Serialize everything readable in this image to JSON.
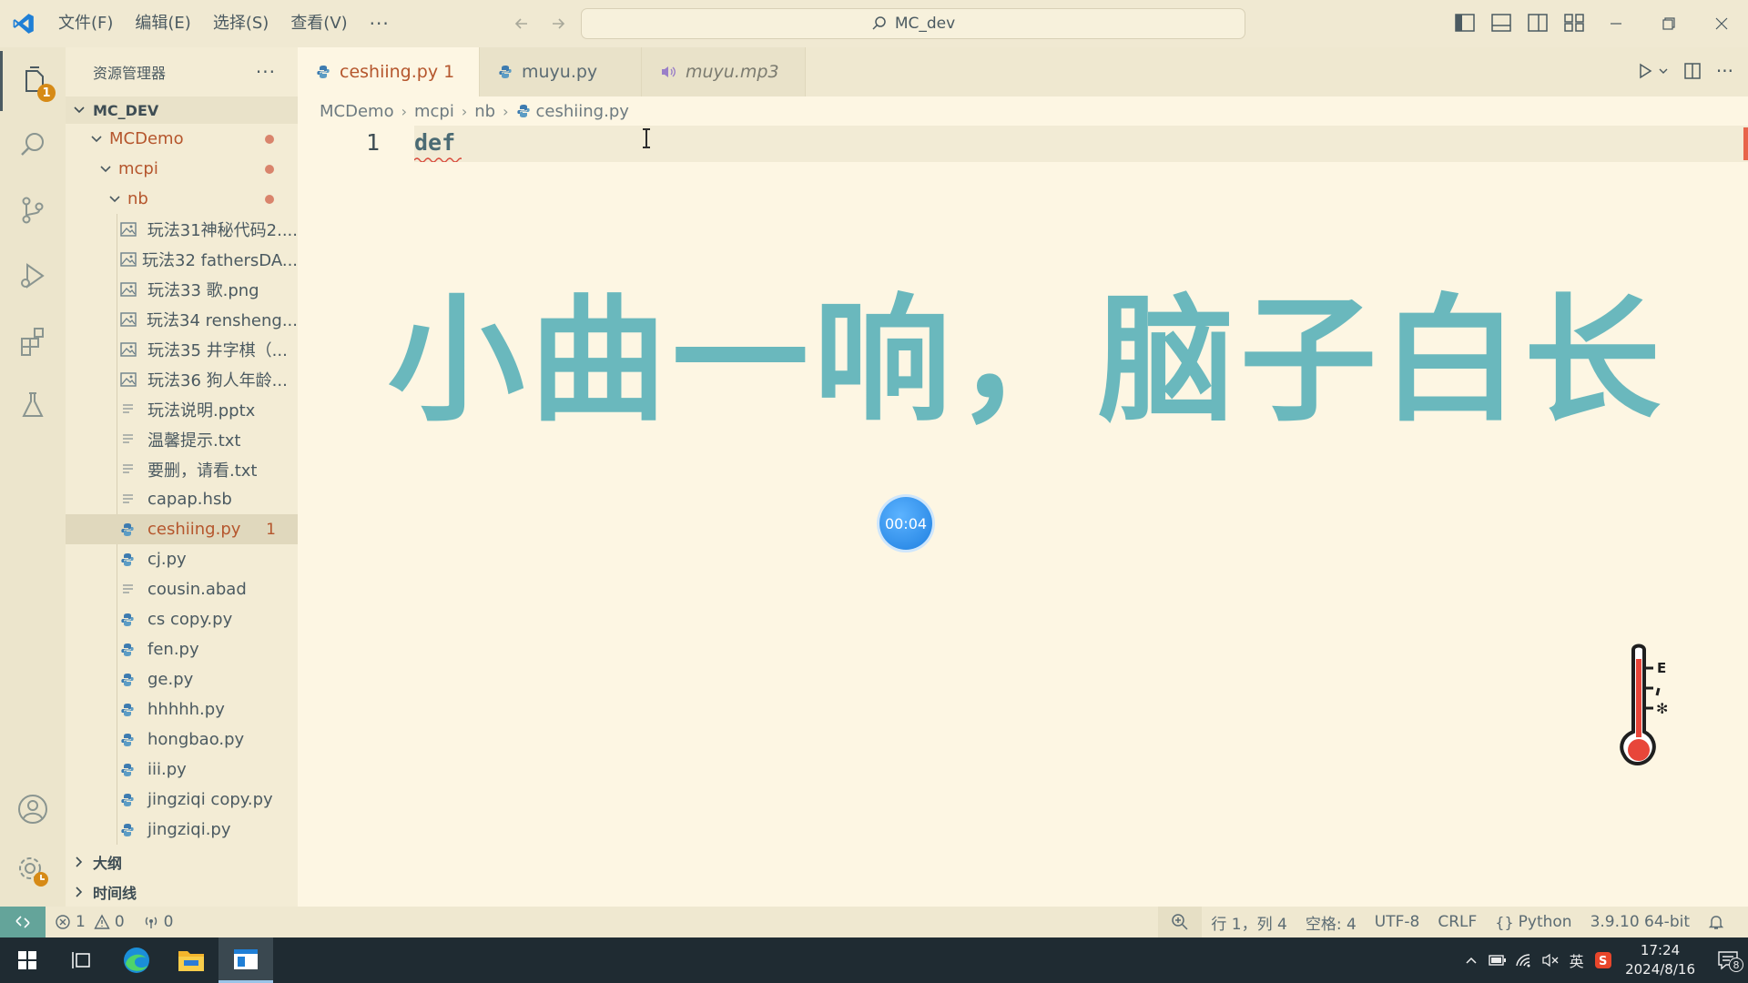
{
  "titlebar": {
    "menu": [
      "文件(F)",
      "编辑(E)",
      "选择(S)",
      "查看(V)",
      "···"
    ],
    "search_text": "MC_dev"
  },
  "activity": {
    "explorer_badge": "1"
  },
  "sidebar": {
    "title": "资源管理器",
    "more": "···",
    "root_label": "MC_DEV",
    "folders": [
      "MCDemo",
      "mcpi",
      "nb"
    ],
    "files": [
      {
        "name": "玩法31神秘代码2....",
        "icon": "image-file-icon"
      },
      {
        "name": "玩法32 fathersDA...",
        "icon": "image-file-icon"
      },
      {
        "name": "玩法33 歌.png",
        "icon": "image-file-icon"
      },
      {
        "name": "玩法34 rensheng...",
        "icon": "image-file-icon"
      },
      {
        "name": "玩法35 井字棋（...",
        "icon": "image-file-icon"
      },
      {
        "name": "玩法36 狗人年龄...",
        "icon": "image-file-icon"
      },
      {
        "name": "玩法说明.pptx",
        "icon": "text-file-icon"
      },
      {
        "name": "温馨提示.txt",
        "icon": "text-file-icon"
      },
      {
        "name": "要删，请看.txt",
        "icon": "text-file-icon"
      },
      {
        "name": "capap.hsb",
        "icon": "text-file-icon"
      },
      {
        "name": "ceshiing.py",
        "icon": "python-file-icon",
        "selected": true,
        "problems": "1"
      },
      {
        "name": "cj.py",
        "icon": "python-file-icon"
      },
      {
        "name": "cousin.abad",
        "icon": "text-file-icon"
      },
      {
        "name": "cs copy.py",
        "icon": "python-file-icon"
      },
      {
        "name": "fen.py",
        "icon": "python-file-icon"
      },
      {
        "name": "ge.py",
        "icon": "python-file-icon"
      },
      {
        "name": "hhhhh.py",
        "icon": "python-file-icon"
      },
      {
        "name": "hongbao.py",
        "icon": "python-file-icon"
      },
      {
        "name": "iii.py",
        "icon": "python-file-icon"
      },
      {
        "name": "jingziqi copy.py",
        "icon": "python-file-icon"
      },
      {
        "name": "jingziqi.py",
        "icon": "python-file-icon"
      }
    ],
    "outline_label": "大纲",
    "timeline_label": "时间线"
  },
  "tabs": [
    {
      "label": "ceshiing.py",
      "suffix": "1",
      "active": true,
      "dirty": true
    },
    {
      "label": "muyu.py"
    },
    {
      "label": "muyu.mp3"
    }
  ],
  "breadcrumb": [
    "MCDemo",
    "mcpi",
    "nb",
    "ceshiing.py"
  ],
  "editor": {
    "line_number": "1",
    "code": "def",
    "overlay_text": "小曲一响，脑子白长",
    "timer": "00:04"
  },
  "statusbar": {
    "errors": "1",
    "warnings": "0",
    "ports": "0",
    "position": "行 1，列 4",
    "spaces": "空格: 4",
    "encoding": "UTF-8",
    "eol": "CRLF",
    "language": "Python",
    "interpreter": "3.9.10 64-bit"
  },
  "taskbar": {
    "ime": "英",
    "time": "17:24",
    "date": "2024/8/16",
    "notifications": "8"
  },
  "colors": {
    "editor_bg": "#fdf6e3",
    "accent_modified": "#b5562d",
    "overlay_text": "#6ab8bd",
    "remote": "#64a49a"
  }
}
